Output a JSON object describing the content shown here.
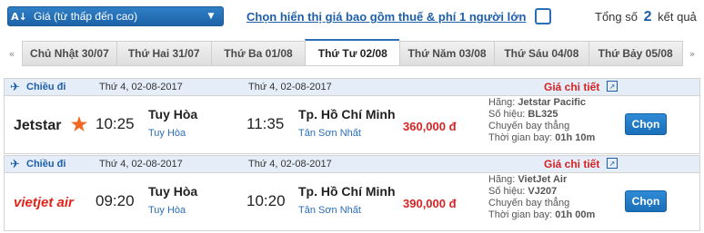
{
  "sort": {
    "label": "Giá (từ thấp đến cao)",
    "icon": "sort-az-icon"
  },
  "fee_option": {
    "label": "Chọn hiển thị giá bao gồm thuế & phí 1 người lớn",
    "checked": false
  },
  "total": {
    "prefix": "Tổng số",
    "count": "2",
    "suffix": "kết quả"
  },
  "date_tabs": [
    {
      "label": "Chủ Nhật 30/07",
      "active": false
    },
    {
      "label": "Thứ Hai 31/07",
      "active": false
    },
    {
      "label": "Thứ Ba 01/08",
      "active": false
    },
    {
      "label": "Thứ Tư 02/08",
      "active": true
    },
    {
      "label": "Thứ Năm 03/08",
      "active": false
    },
    {
      "label": "Thứ Sáu 04/08",
      "active": false
    },
    {
      "label": "Thứ Bảy 05/08",
      "active": false
    }
  ],
  "nav": {
    "prev_arrow": "«",
    "next_arrow": "»"
  },
  "flights": [
    {
      "direction_label": "Chiều đi",
      "dep_date": "Thứ 4, 02-08-2017",
      "arr_date": "Thứ 4, 02-08-2017",
      "detail_label": "Giá chi tiết",
      "airline_logo": "Jetstar",
      "dep_time": "10:25",
      "dep_city": "Tuy Hòa",
      "dep_airport": "Tuy Hòa",
      "arr_time": "11:35",
      "arr_city": "Tp. Hồ Chí Minh",
      "arr_airport": "Tân Sơn Nhất",
      "price": "360,000 đ",
      "airline_line": "Hãng: ",
      "airline": "Jetstar Pacific",
      "flight_no_line": "Số hiệu: ",
      "flight_no": "BL325",
      "flight_type": "Chuyến bay thẳng",
      "duration_line": "Thời gian bay: ",
      "duration": "01h 10m",
      "book_label": "Chọn"
    },
    {
      "direction_label": "Chiều đi",
      "dep_date": "Thứ 4, 02-08-2017",
      "arr_date": "Thứ 4, 02-08-2017",
      "detail_label": "Giá chi tiết",
      "airline_logo": "vietjet air",
      "dep_time": "09:20",
      "dep_city": "Tuy Hòa",
      "dep_airport": "Tuy Hòa",
      "arr_time": "10:20",
      "arr_city": "Tp. Hồ Chí Minh",
      "arr_airport": "Tân Sơn Nhất",
      "price": "390,000 đ",
      "airline_line": "Hãng: ",
      "airline": "VietJet Air",
      "flight_no_line": "Số hiệu: ",
      "flight_no": "VJ207",
      "flight_type": "Chuyến bay thẳng",
      "duration_line": "Thời gian bay: ",
      "duration": "01h 00m",
      "book_label": "Chọn"
    }
  ],
  "colors": {
    "brand_blue": "#1e5ea8",
    "price_red": "#d62323",
    "jetstar_orange": "#f26722",
    "vietjet_red": "#e2231a"
  }
}
